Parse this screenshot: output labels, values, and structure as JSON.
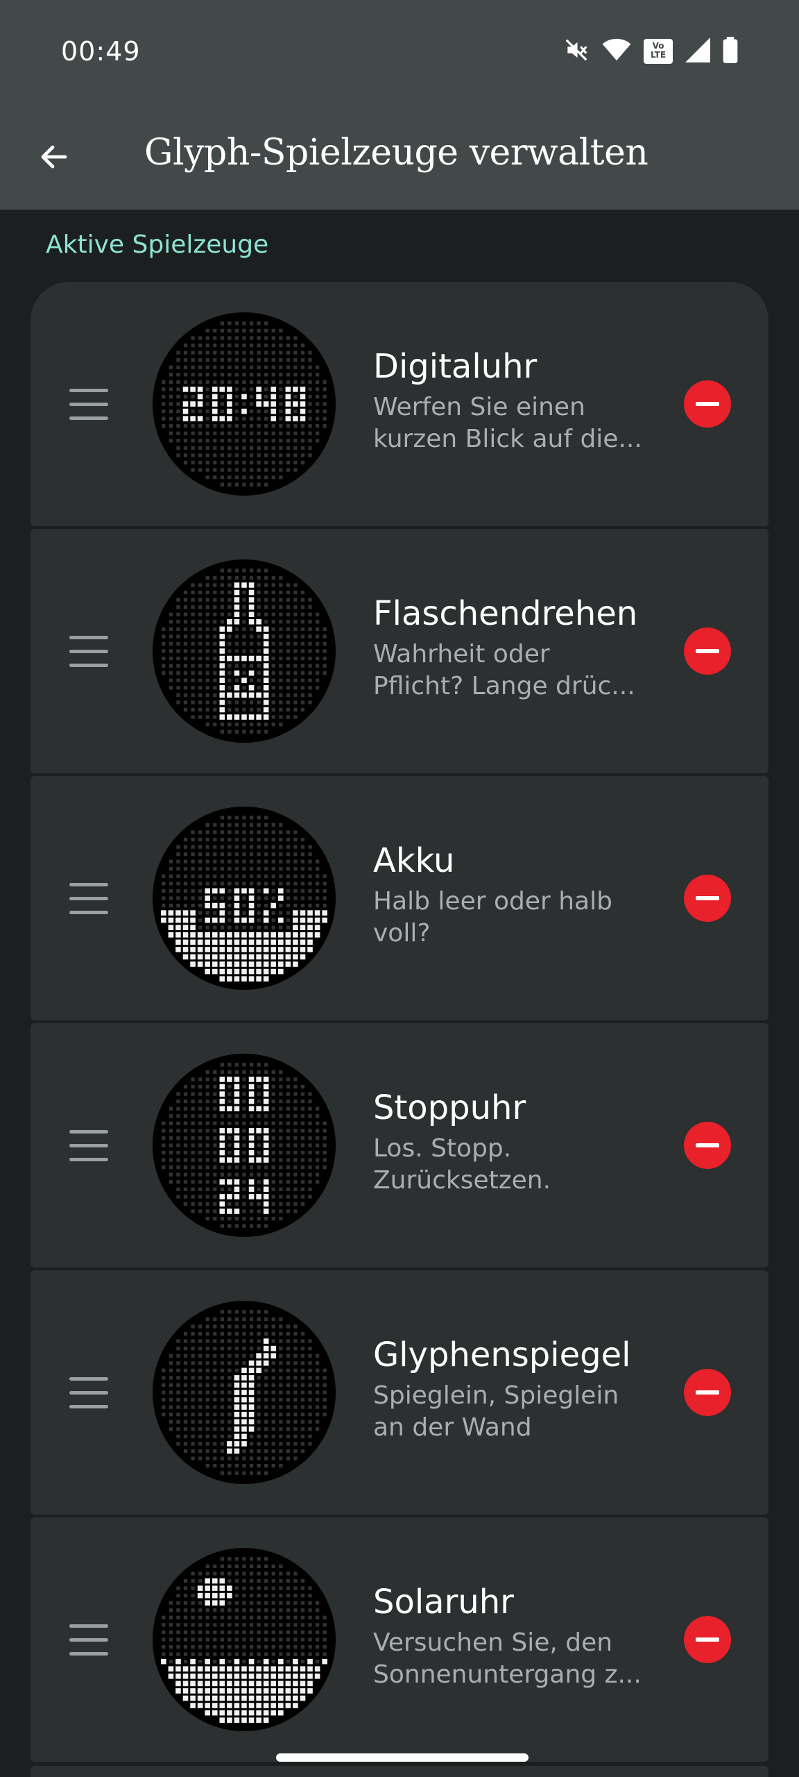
{
  "status_bar": {
    "time": "00:49",
    "icons": [
      "mute-icon",
      "wifi-icon",
      "volte-icon",
      "signal-icon",
      "battery-icon"
    ],
    "volte_label": "Vo\nLTE"
  },
  "header": {
    "title": "Glyph-Spielzeuge verwalten",
    "back_icon": "arrow-left-icon"
  },
  "section": {
    "label": "Aktive Spielzeuge"
  },
  "toys": [
    {
      "id": "digitaluhr",
      "title": "Digitaluhr",
      "description": "Werfen Sie einen\nkurzen Blick auf die...",
      "preview_text": "20:48"
    },
    {
      "id": "flaschendrehen",
      "title": "Flaschendrehen",
      "description": "Wahrheit oder\nPflicht? Lange drüc..."
    },
    {
      "id": "akku",
      "title": "Akku",
      "description": "Halb leer oder halb\nvoll?",
      "preview_text": "50%",
      "level": 0.5
    },
    {
      "id": "stoppuhr",
      "title": "Stoppuhr",
      "description": "Los. Stopp.\nZurücksetzen.",
      "preview_text": [
        "00",
        "00",
        "24"
      ]
    },
    {
      "id": "glyphenspiegel",
      "title": "Glyphenspiegel",
      "description": "Spieglein, Spieglein\nan der Wand"
    },
    {
      "id": "solaruhr",
      "title": "Solaruhr",
      "description": "Versuchen Sie, den\nSonnenuntergang z..."
    }
  ],
  "colors": {
    "accent": "#8fe3d3",
    "remove": "#e8212b",
    "card": "#2c3030",
    "bar": "#434848",
    "background": "#1b1f1f"
  }
}
